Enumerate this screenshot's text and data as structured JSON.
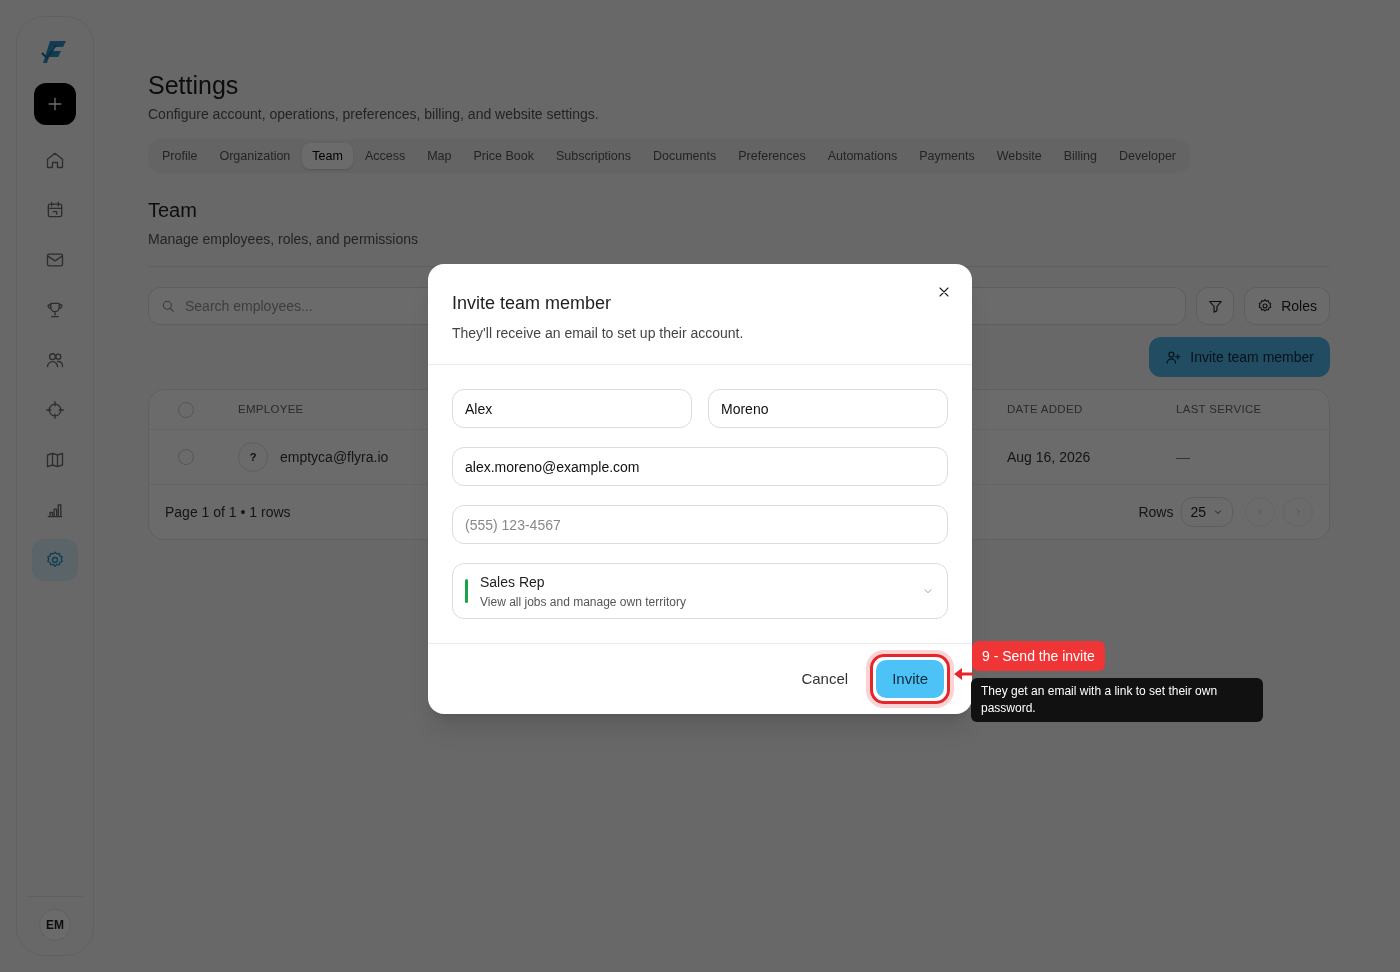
{
  "sidebar": {
    "items": [
      {
        "kind": "home",
        "selected": false
      },
      {
        "kind": "calendar",
        "selected": false
      },
      {
        "kind": "mail",
        "selected": false
      },
      {
        "kind": "trophy",
        "selected": false
      },
      {
        "kind": "users",
        "selected": false
      },
      {
        "kind": "target",
        "selected": false
      },
      {
        "kind": "map",
        "selected": false
      },
      {
        "kind": "chart",
        "selected": false
      },
      {
        "kind": "settings",
        "selected": true
      }
    ],
    "avatar": "EM"
  },
  "header": {
    "title": "Settings",
    "subtitle": "Configure account, operations, preferences, billing, and website settings."
  },
  "tabs": [
    {
      "label": "Profile",
      "selected": false
    },
    {
      "label": "Organization",
      "selected": false
    },
    {
      "label": "Team",
      "selected": true
    },
    {
      "label": "Access",
      "selected": false
    },
    {
      "label": "Map",
      "selected": false
    },
    {
      "label": "Price Book",
      "selected": false
    },
    {
      "label": "Subscriptions",
      "selected": false
    },
    {
      "label": "Documents",
      "selected": false
    },
    {
      "label": "Preferences",
      "selected": false
    },
    {
      "label": "Automations",
      "selected": false
    },
    {
      "label": "Payments",
      "selected": false
    },
    {
      "label": "Website",
      "selected": false
    },
    {
      "label": "Billing",
      "selected": false
    },
    {
      "label": "Developer",
      "selected": false
    }
  ],
  "section": {
    "title": "Team",
    "subtitle": "Manage employees, roles, and permissions"
  },
  "toolbar": {
    "search_placeholder": "Search employees...",
    "roles_button": "Roles",
    "invite_button": "Invite team member"
  },
  "table": {
    "header_checked": false,
    "columns": [
      "EMPLOYEE",
      "DATE ADDED",
      "LAST SERVICE"
    ],
    "rows": [
      {
        "checked": false,
        "avatar": "?",
        "email": "emptyca@flyra.io",
        "date_added": "Aug 16, 2026",
        "last_service": "—"
      }
    ]
  },
  "pagination": {
    "summary": "Page 1 of 1 • 1 rows",
    "rows_label": "Rows",
    "rows_value": "25"
  },
  "modal": {
    "title": "Invite team member",
    "subtitle": "They'll receive an email to set up their account.",
    "first_name": "Alex",
    "last_name": "Moreno",
    "email": "alex.moreno@example.com",
    "phone_placeholder": "(555) 123-4567",
    "role": {
      "name": "Sales Rep",
      "description": "View all jobs and manage own territory",
      "color": "#16a34a"
    },
    "cancel": "Cancel",
    "submit": "Invite"
  },
  "tour": {
    "step": "9 - Send the invite",
    "tip": "They get an email with a link to set their own password."
  }
}
